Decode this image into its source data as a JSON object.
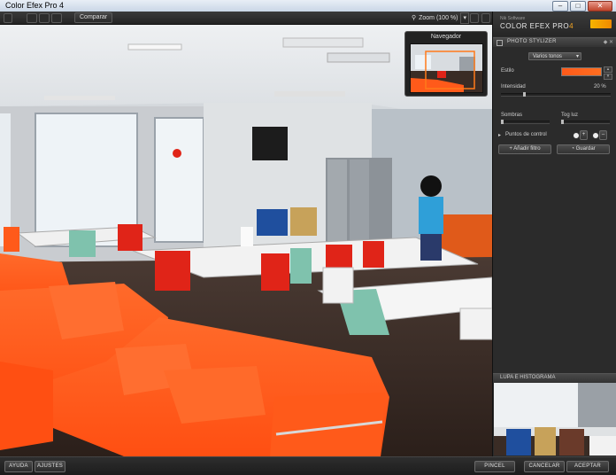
{
  "window": {
    "title": "Color Efex Pro 4",
    "minimize": "–",
    "maximize": "□",
    "close": "✕"
  },
  "toolbar": {
    "compare_label": "Comparar",
    "zoom_label": "Zoom (100 %)"
  },
  "navigator": {
    "title": "Navegador"
  },
  "panel": {
    "brand_small": "Nik Software",
    "brand_main": "COLOR EFEX PRO",
    "brand_version": "4",
    "filter_title": "PHOTO STYLIZER",
    "filter_controls": "◆ ✕",
    "preset_value": "Varios tonos",
    "style_label": "Estilo",
    "intensity_label": "Intensidad",
    "intensity_value": "20 %",
    "intensity_fraction": 0.2,
    "shadows_label": "Sombras",
    "highlights_label": "Tog luz",
    "control_points_label": "Puntos de control",
    "add_filter_label": "Añadir filtro",
    "save_label": "Guardar",
    "loupe_title": "LUPA E HISTOGRAMA"
  },
  "bottom": {
    "help_label": "AYUDA",
    "settings_label": "AJUSTES",
    "brush_label": "PINCEL",
    "cancel_label": "CANCELAR",
    "accept_label": "ACEPTAR"
  },
  "colors": {
    "accent": "#f5a623",
    "sofa": "#ff5a1a",
    "chair_red": "#e02418",
    "chair_mint": "#7fc2ad"
  }
}
